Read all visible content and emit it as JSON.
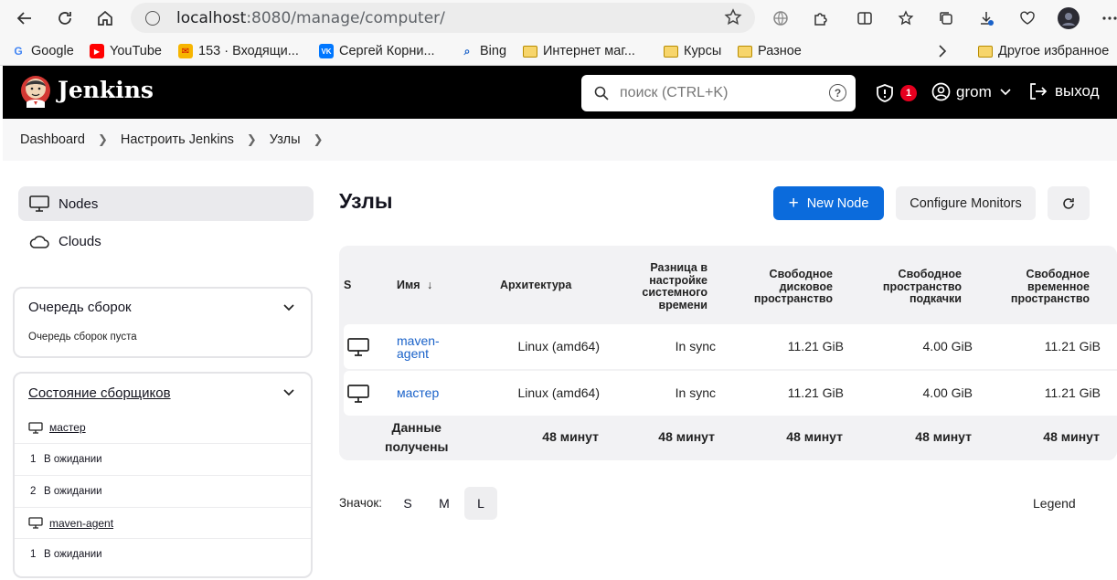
{
  "browser": {
    "url_host": "localhost",
    "url_path": ":8080/manage/computer/",
    "bookmarks": [
      {
        "label": "Google",
        "icon": "google-icon"
      },
      {
        "label": "YouTube",
        "icon": "youtube-icon"
      },
      {
        "label": "153 · Входящи...",
        "icon": "mail-icon"
      },
      {
        "label": "Сергей Корни...",
        "icon": "vk-icon"
      },
      {
        "label": "Bing",
        "icon": "bing-icon"
      },
      {
        "label": "Интернет маг...",
        "icon": "folder-icon"
      },
      {
        "label": "Курсы",
        "icon": "folder-icon"
      },
      {
        "label": "Разное",
        "icon": "folder-icon"
      },
      {
        "label": "Другое избранное",
        "icon": "folder-icon"
      }
    ]
  },
  "header": {
    "brand": "Jenkins",
    "search_placeholder": "поиск (CTRL+K)",
    "help": "?",
    "alerts_count": "1",
    "user": "grom",
    "logout": "выход"
  },
  "breadcrumbs": [
    "Dashboard",
    "Настроить Jenkins",
    "Узлы"
  ],
  "sidebar": {
    "tasks": [
      {
        "label": "Nodes",
        "active": true
      },
      {
        "label": "Clouds",
        "active": false
      }
    ],
    "build_queue": {
      "title": "Очередь сборок",
      "empty_text": "Очередь сборок пуста"
    },
    "executors": {
      "title": "Состояние сборщиков",
      "computers": [
        {
          "name": "мастер",
          "executors": [
            {
              "num": "1",
              "status": "В ожидании"
            },
            {
              "num": "2",
              "status": "В ожидании"
            }
          ]
        },
        {
          "name": "maven-agent",
          "executors": [
            {
              "num": "1",
              "status": "В ожидании"
            }
          ]
        }
      ]
    }
  },
  "main": {
    "title": "Узлы",
    "new_node": "New Node",
    "configure_monitors": "Configure Monitors",
    "columns": {
      "s": "S",
      "name": "Имя",
      "sort_arrow": "↓",
      "arch": "Архитектура",
      "clock_line1": "Разница в",
      "clock_line2": "настройке",
      "clock_line3": "системного",
      "clock_line4": "времени",
      "disk_line1": "Свободное",
      "disk_line2": "дисковое",
      "disk_line3": "пространство",
      "swap_line1": "Свободное",
      "swap_line2": "пространство",
      "swap_line3": "подкачки",
      "temp_line1": "Свободное",
      "temp_line2": "временное",
      "temp_line3": "пространство"
    },
    "rows": [
      {
        "name_line1": "maven-",
        "name_line2": "agent",
        "arch": "Linux (amd64)",
        "clock": "In sync",
        "disk": "11.21 GiB",
        "swap": "4.00 GiB",
        "temp": "11.21 GiB"
      },
      {
        "name": "мастер",
        "arch": "Linux (amd64)",
        "clock": "In sync",
        "disk": "11.21 GiB",
        "swap": "4.00 GiB",
        "temp": "11.21 GiB"
      }
    ],
    "footer": {
      "label_line1": "Данные",
      "label_line2": "получены",
      "arch": "48 минут",
      "clock": "48 минут",
      "disk": "48 минут",
      "swap": "48 минут",
      "temp": "48 минут"
    },
    "icon_size_label": "Значок:",
    "icon_sizes": [
      "S",
      "M",
      "L"
    ],
    "selected_icon_size": "L",
    "legend": "Legend"
  },
  "colors": {
    "accent": "#0b6bdc",
    "link": "#1a62c9",
    "header_bg": "#000000",
    "badge": "#e6001f"
  }
}
